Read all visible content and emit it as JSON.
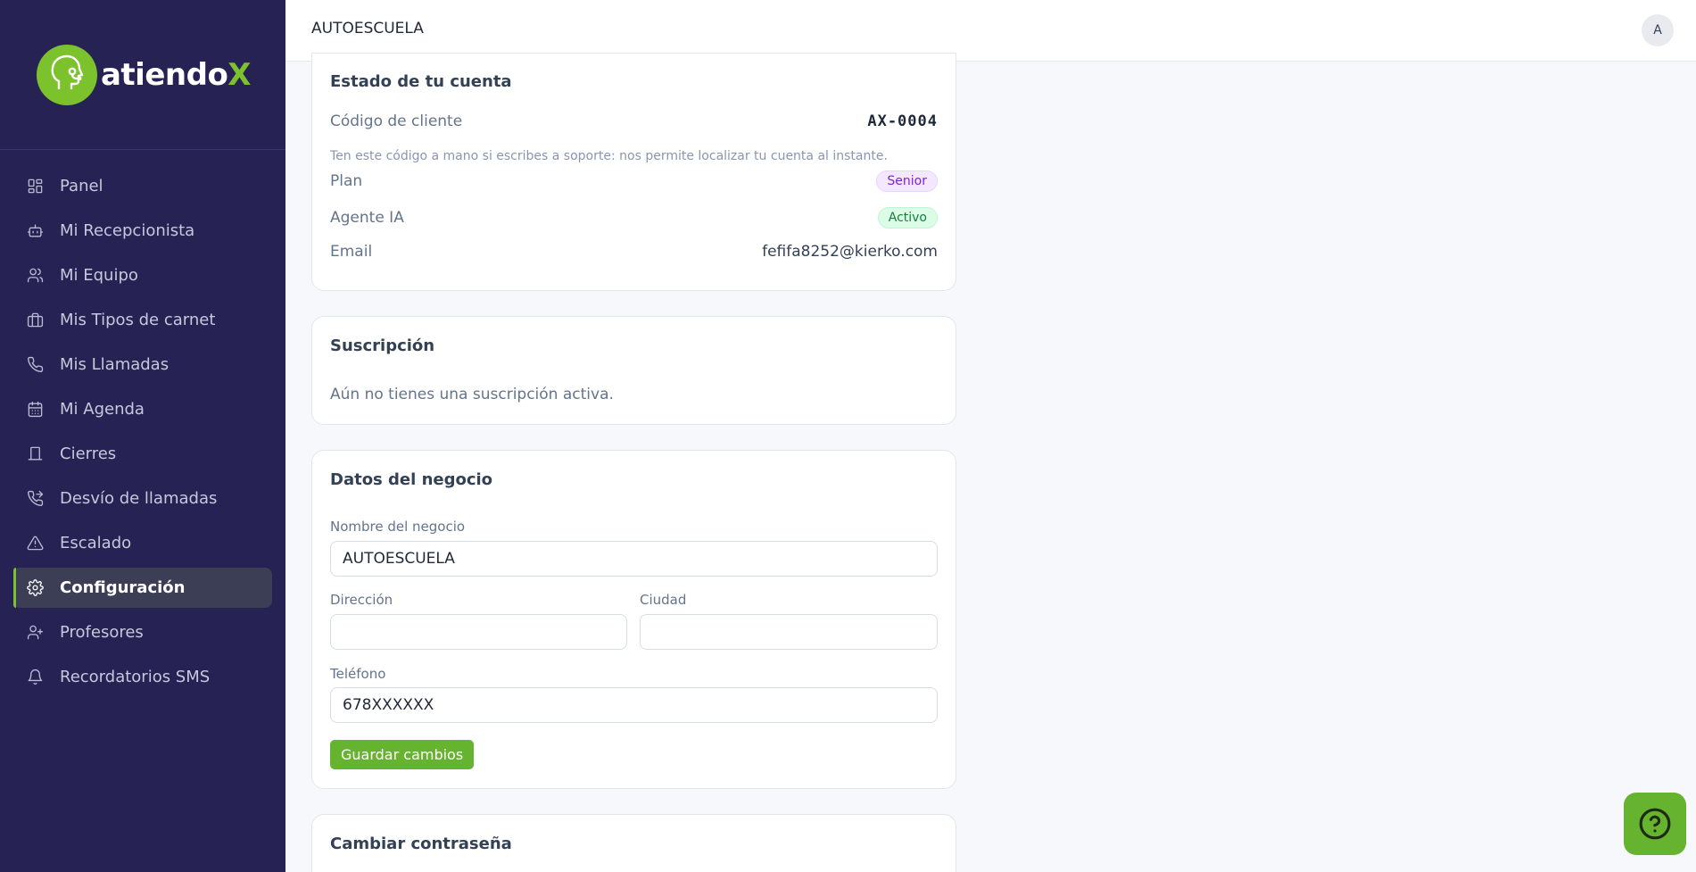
{
  "brand": {
    "name_main": "atiendo",
    "name_accent": "X",
    "accent_color": "#7cc22c",
    "sidebar_bg": "#272254"
  },
  "sidebar": {
    "items": [
      {
        "label": "Panel",
        "icon": "grid-icon"
      },
      {
        "label": "Mi Recepcionista",
        "icon": "robot-icon"
      },
      {
        "label": "Mi Equipo",
        "icon": "users-icon"
      },
      {
        "label": "Mis Tipos de carnet",
        "icon": "briefcase-icon"
      },
      {
        "label": "Mis Llamadas",
        "icon": "phone-icon"
      },
      {
        "label": "Mi Agenda",
        "icon": "calendar-icon"
      },
      {
        "label": "Cierres",
        "icon": "door-icon"
      },
      {
        "label": "Desvío de llamadas",
        "icon": "phone-forward-icon"
      },
      {
        "label": "Escalado",
        "icon": "alert-triangle-icon"
      },
      {
        "label": "Configuración",
        "icon": "gear-icon",
        "active": true
      },
      {
        "label": "Profesores",
        "icon": "user-plus-icon"
      },
      {
        "label": "Recordatorios SMS",
        "icon": "bell-icon"
      }
    ]
  },
  "header": {
    "title": "AUTOESCUELA",
    "avatar_initial": "A"
  },
  "account": {
    "title": "Estado de tu cuenta",
    "client_code_label": "Código de cliente",
    "client_code": "AX-0004",
    "hint": "Ten este código a mano si escribes a soporte: nos permite localizar tu cuenta al instante.",
    "plan_label": "Plan",
    "plan_value": "Senior",
    "agent_label": "Agente IA",
    "agent_value": "Activo",
    "email_label": "Email",
    "email_value": "fefifa8252@kierko.com"
  },
  "subscription": {
    "title": "Suscripción",
    "text": "Aún no tienes una suscripción activa."
  },
  "business": {
    "title": "Datos del negocio",
    "name_label": "Nombre del negocio",
    "name_value": "AUTOESCUELA",
    "address_label": "Dirección",
    "address_value": "",
    "city_label": "Ciudad",
    "city_value": "",
    "phone_label": "Teléfono",
    "phone_value": "678XXXXXX",
    "save_label": "Guardar cambios"
  },
  "password": {
    "title": "Cambiar contraseña"
  },
  "help": {
    "icon": "help-circle-icon"
  }
}
